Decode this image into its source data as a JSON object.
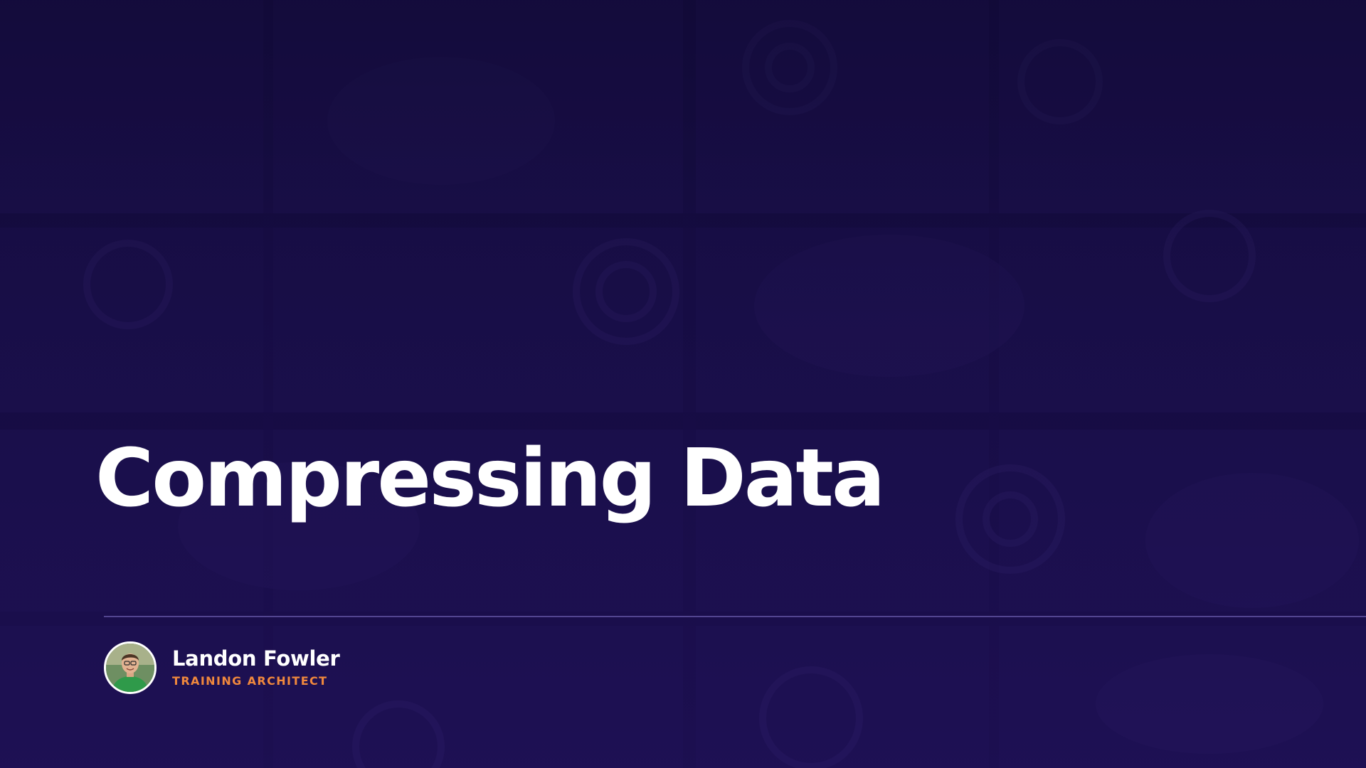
{
  "slide": {
    "title": "Compressing Data",
    "presenter": {
      "name": "Landon Fowler",
      "role": "TRAINING ARCHITECT",
      "avatar_icon": "person-avatar-icon"
    }
  },
  "colors": {
    "background": "#160d3c",
    "title": "#ffffff",
    "accent": "#f0883d",
    "divider": "#8273c8"
  }
}
